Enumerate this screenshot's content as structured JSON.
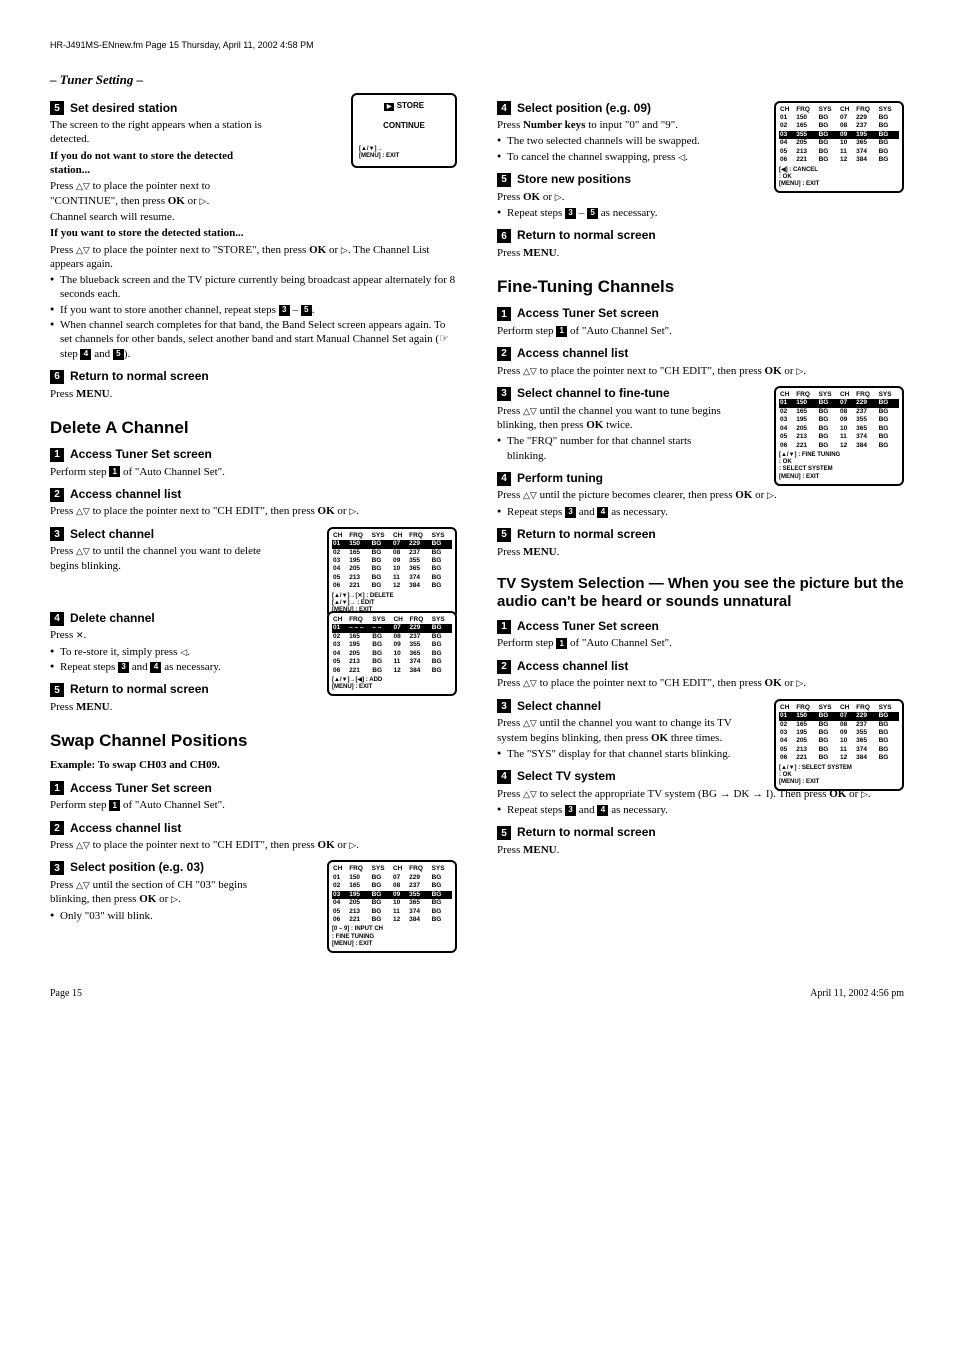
{
  "header": {
    "file_info": "HR-J491MS-ENnew.fm  Page 15  Thursday, April 11, 2002  4:58 PM"
  },
  "section_bar": "– Tuner Setting –",
  "left": {
    "s5": {
      "num": "5",
      "title": "Set desired station",
      "p1": "The screen to the right appears when a station is detected.",
      "p2": "If you do not want to store the detected station...",
      "p3a": "Press ",
      "p3b": " to place the pointer next to \"CONTINUE\", then press ",
      "p3_ok": "OK",
      "p3c": " or ",
      "p3d": ".",
      "p4": "Channel search will resume.",
      "p5": "If you want to store the detected station...",
      "p6a": "Press ",
      "p6b": " to place the pointer next to \"STORE\", then press ",
      "p6_ok": "OK",
      "p6c": " or ",
      "p6d": ". The Channel List appears again.",
      "b1": "The blueback screen and the TV picture currently being broadcast appear alternately for 8 seconds each.",
      "b2a": "If you want to store another channel, repeat steps ",
      "b2b": " – ",
      "b3a": "When channel search completes for that band, the Band Select screen appears again. To set channels for other bands, select another band and start Manual Channel Set again (",
      "b3b": " step ",
      "b3c": " and ",
      "b3d": ")."
    },
    "s6": {
      "num": "6",
      "title": "Return to normal screen",
      "p1a": "Press ",
      "p1_menu": "MENU",
      "p1b": "."
    },
    "delete": {
      "h1": "Delete A Channel",
      "s1": {
        "num": "1",
        "title": "Access Tuner Set screen",
        "p1a": "Perform step ",
        "p1b": " of \"Auto Channel Set\"."
      },
      "s2": {
        "num": "2",
        "title": "Access channel list",
        "p1a": "Press ",
        "p1b": " to place the pointer next to \"CH EDIT\", then press ",
        "p1_ok": "OK",
        "p1c": " or ",
        "p1d": "."
      },
      "s3": {
        "num": "3",
        "title": "Select channel",
        "p1a": "Press ",
        "p1b": " to until the channel you want to delete begins blinking."
      },
      "s4": {
        "num": "4",
        "title": "Delete channel",
        "p1a": "Press ",
        "p1b": ".",
        "b1a": "To re-store it, simply press ",
        "b1b": ".",
        "b2a": "Repeat steps ",
        "b2b": " and ",
        "b2c": " as necessary."
      },
      "s5": {
        "num": "5",
        "title": "Return to normal screen",
        "p1a": "Press ",
        "p1_menu": "MENU",
        "p1b": "."
      }
    },
    "swap": {
      "h1": "Swap Channel Positions",
      "ex": "Example: To swap CH03 and CH09.",
      "s1": {
        "num": "1",
        "title": "Access Tuner Set screen",
        "p1a": "Perform step ",
        "p1b": " of \"Auto Channel Set\"."
      },
      "s2": {
        "num": "2",
        "title": "Access channel list",
        "p1a": "Press ",
        "p1b": " to place the pointer next to \"CH EDIT\", then press ",
        "p1_ok": "OK",
        "p1c": " or ",
        "p1d": "."
      },
      "s3": {
        "num": "3",
        "title": "Select position (e.g. 03)",
        "p1a": "Press ",
        "p1b": " until the section of CH \"03\" begins blinking, then press ",
        "p1_ok": "OK",
        "p1c": " or ",
        "p1d": ".",
        "b1": "Only \"03\" will blink."
      }
    },
    "osd_store": {
      "l1": "STORE",
      "l2": "CONTINUE",
      "f1": "[▲/▼]→",
      "f2": "[MENU] : EXIT"
    },
    "osd_delete1": {
      "hdr": [
        "CH",
        "FRQ",
        "SYS",
        "CH",
        "FRQ",
        "SYS"
      ],
      "rows": [
        [
          "01",
          "150",
          "BG",
          "07",
          "229",
          "BG"
        ],
        [
          "02",
          "165",
          "BG",
          "08",
          "237",
          "BG"
        ],
        [
          "03",
          "195",
          "BG",
          "09",
          "355",
          "BG"
        ],
        [
          "04",
          "205",
          "BG",
          "10",
          "365",
          "BG"
        ],
        [
          "05",
          "213",
          "BG",
          "11",
          "374",
          "BG"
        ],
        [
          "06",
          "221",
          "BG",
          "12",
          "384",
          "BG"
        ]
      ],
      "f1": "[▲/▼]→[✕] : DELETE",
      "f2": "[▲/▼]→  : EDIT",
      "f3": "[MENU] : EXIT"
    },
    "osd_delete2": {
      "hdr": [
        "CH",
        "FRQ",
        "SYS",
        "CH",
        "FRQ",
        "SYS"
      ],
      "rows": [
        [
          "01",
          "– – –",
          "– –",
          "07",
          "229",
          "BG"
        ],
        [
          "02",
          "165",
          "BG",
          "08",
          "237",
          "BG"
        ],
        [
          "03",
          "195",
          "BG",
          "09",
          "355",
          "BG"
        ],
        [
          "04",
          "205",
          "BG",
          "10",
          "365",
          "BG"
        ],
        [
          "05",
          "213",
          "BG",
          "11",
          "374",
          "BG"
        ],
        [
          "06",
          "221",
          "BG",
          "12",
          "384",
          "BG"
        ]
      ],
      "f1": "[▲/▼]→[◀] : ADD",
      "f2": "[MENU] : EXIT"
    },
    "osd_swap1": {
      "hdr": [
        "CH",
        "FRQ",
        "SYS",
        "CH",
        "FRQ",
        "SYS"
      ],
      "rows": [
        [
          "01",
          "150",
          "BG",
          "07",
          "229",
          "BG"
        ],
        [
          "02",
          "165",
          "BG",
          "08",
          "237",
          "BG"
        ],
        [
          "03",
          "195",
          "BG",
          "09",
          "355",
          "BG"
        ],
        [
          "04",
          "205",
          "BG",
          "10",
          "365",
          "BG"
        ],
        [
          "05",
          "213",
          "BG",
          "11",
          "374",
          "BG"
        ],
        [
          "06",
          "221",
          "BG",
          "12",
          "384",
          "BG"
        ]
      ],
      "f1": "[0 – 9] : INPUT CH",
      "f2": " : FINE TUNING",
      "f3": "[MENU] : EXIT"
    }
  },
  "right": {
    "s4": {
      "num": "4",
      "title": "Select position (e.g. 09)",
      "p1a": "Press ",
      "p1_nk": "Number keys",
      "p1b": " to input \"0\" and \"9\".",
      "b1": "The two selected channels will be swapped.",
      "b2a": "To cancel the channel swapping, press ",
      "b2b": "."
    },
    "s5": {
      "num": "5",
      "title": "Store new positions",
      "p1a": "Press ",
      "p1_ok": "OK",
      "p1b": " or ",
      "p1c": ".",
      "b1a": "Repeat steps ",
      "b1b": " – ",
      "b1c": " as necessary."
    },
    "s6": {
      "num": "6",
      "title": "Return to normal screen",
      "p1a": "Press ",
      "p1_menu": "MENU",
      "p1b": "."
    },
    "fine": {
      "h1": "Fine-Tuning Channels",
      "s1": {
        "num": "1",
        "title": "Access Tuner Set screen",
        "p1a": "Perform step ",
        "p1b": " of \"Auto Channel Set\"."
      },
      "s2": {
        "num": "2",
        "title": "Access channel list",
        "p1a": "Press ",
        "p1b": " to place the pointer next to \"CH EDIT\", then press ",
        "p1_ok": "OK",
        "p1c": " or ",
        "p1d": "."
      },
      "s3": {
        "num": "3",
        "title": "Select channel to fine-tune",
        "p1a": "Press ",
        "p1b": " until the channel you want to tune begins blinking, then press ",
        "p1_ok": "OK",
        "p1c": " twice.",
        "b1": "The \"FRQ\" number for that channel starts blinking."
      },
      "s4": {
        "num": "4",
        "title": "Perform tuning",
        "p1a": "Press ",
        "p1b": " until the picture becomes clearer, then press ",
        "p1_ok": "OK",
        "p1c": " or ",
        "p1d": ".",
        "b1a": "Repeat steps ",
        "b1b": " and ",
        "b1c": " as necessary."
      },
      "s5": {
        "num": "5",
        "title": "Return to normal screen",
        "p1a": "Press ",
        "p1_menu": "MENU",
        "p1b": "."
      }
    },
    "tvsys": {
      "h1": "TV System Selection — When you see the picture but the audio can't be heard or sounds unnatural",
      "s1": {
        "num": "1",
        "title": "Access Tuner Set screen",
        "p1a": "Perform step ",
        "p1b": " of \"Auto Channel Set\"."
      },
      "s2": {
        "num": "2",
        "title": "Access channel list",
        "p1a": "Press ",
        "p1b": " to place the pointer next to \"CH EDIT\", then press ",
        "p1_ok": "OK",
        "p1c": " or ",
        "p1d": "."
      },
      "s3": {
        "num": "3",
        "title": "Select channel",
        "p1a": "Press ",
        "p1b": " until the channel you want to change its TV system begins blinking, then press ",
        "p1_ok": "OK",
        "p1c": " three times.",
        "b1": "The \"SYS\" display for that channel starts blinking."
      },
      "s4": {
        "num": "4",
        "title": "Select TV system",
        "p1a": "Press ",
        "p1b": " to select the appropriate TV system (BG → DK → I). Then press ",
        "p1_ok": "OK",
        "p1c": " or ",
        "p1d": ".",
        "b1a": "Repeat steps ",
        "b1b": " and ",
        "b1c": " as necessary."
      },
      "s5": {
        "num": "5",
        "title": "Return to normal screen",
        "p1a": "Press ",
        "p1_menu": "MENU",
        "p1b": "."
      }
    },
    "osd_swap2": {
      "hdr": [
        "CH",
        "FRQ",
        "SYS",
        "CH",
        "FRQ",
        "SYS"
      ],
      "rows": [
        [
          "01",
          "150",
          "BG",
          "07",
          "229",
          "BG"
        ],
        [
          "02",
          "165",
          "BG",
          "08",
          "237",
          "BG"
        ],
        [
          "03",
          "355",
          "BG",
          "09",
          "195",
          "BG"
        ],
        [
          "04",
          "205",
          "BG",
          "10",
          "365",
          "BG"
        ],
        [
          "05",
          "213",
          "BG",
          "11",
          "374",
          "BG"
        ],
        [
          "06",
          "221",
          "BG",
          "12",
          "384",
          "BG"
        ]
      ],
      "f1": "[◀] : CANCEL",
      "f2": " : OK",
      "f3": "[MENU] : EXIT"
    },
    "osd_fine": {
      "hdr": [
        "CH",
        "FRQ",
        "SYS",
        "CH",
        "FRQ",
        "SYS"
      ],
      "rows": [
        [
          "01",
          "150",
          "BG",
          "07",
          "229",
          "BG"
        ],
        [
          "02",
          "165",
          "BG",
          "08",
          "237",
          "BG"
        ],
        [
          "03",
          "195",
          "BG",
          "09",
          "355",
          "BG"
        ],
        [
          "04",
          "205",
          "BG",
          "10",
          "365",
          "BG"
        ],
        [
          "05",
          "213",
          "BG",
          "11",
          "374",
          "BG"
        ],
        [
          "06",
          "221",
          "BG",
          "12",
          "384",
          "BG"
        ]
      ],
      "f1": "[▲/▼] : FINE TUNING",
      "f2": " : OK",
      "f3": " : SELECT SYSTEM",
      "f4": "[MENU] : EXIT"
    },
    "osd_tvsys": {
      "hdr": [
        "CH",
        "FRQ",
        "SYS",
        "CH",
        "FRQ",
        "SYS"
      ],
      "rows": [
        [
          "01",
          "150",
          "BG",
          "07",
          "229",
          "BG"
        ],
        [
          "02",
          "165",
          "BG",
          "08",
          "237",
          "BG"
        ],
        [
          "03",
          "195",
          "BG",
          "09",
          "355",
          "BG"
        ],
        [
          "04",
          "205",
          "BG",
          "10",
          "365",
          "BG"
        ],
        [
          "05",
          "213",
          "BG",
          "11",
          "374",
          "BG"
        ],
        [
          "06",
          "221",
          "BG",
          "12",
          "384",
          "BG"
        ]
      ],
      "f1": "[▲/▼] : SELECT SYSTEM",
      "f2": " : OK",
      "f3": "[MENU] : EXIT"
    }
  },
  "footer": {
    "page": "Page 15",
    "date": "April 11, 2002  4:56 pm"
  }
}
